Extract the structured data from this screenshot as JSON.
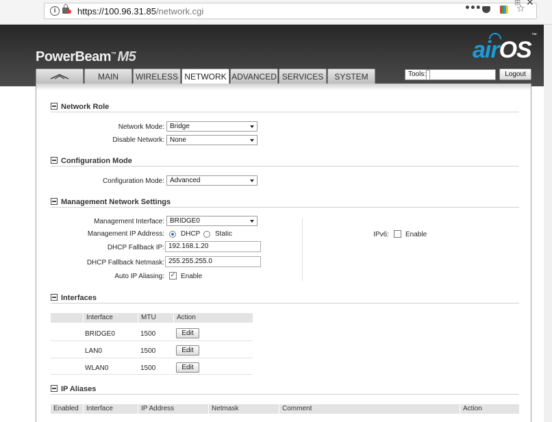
{
  "browser": {
    "url_host": "https://100.96.31.85",
    "url_path": "/network.cgi",
    "icons": [
      "info-icon",
      "lock-icon",
      "more-dots-icon",
      "pocket-icon",
      "extension-icon",
      "bookmark-star-icon",
      "close-icon"
    ]
  },
  "header": {
    "product": "PowerBeam",
    "model": "M5",
    "logo_air": "air",
    "logo_os": "OS",
    "tm": "™"
  },
  "tabs": [
    {
      "label": "",
      "icon": "ubiquiti-logo-icon"
    },
    {
      "label": "MAIN"
    },
    {
      "label": "WIRELESS"
    },
    {
      "label": "NETWORK",
      "active": true
    },
    {
      "label": "ADVANCED"
    },
    {
      "label": "SERVICES"
    },
    {
      "label": "SYSTEM"
    }
  ],
  "tools": {
    "value": "Tools:",
    "logout": "Logout"
  },
  "network_role": {
    "title": "Network Role",
    "mode_label": "Network Mode:",
    "mode_value": "Bridge",
    "disable_label": "Disable Network:",
    "disable_value": "None"
  },
  "configuration_mode": {
    "title": "Configuration Mode",
    "label": "Configuration Mode:",
    "value": "Advanced"
  },
  "management": {
    "title": "Management Network Settings",
    "interface_label": "Management Interface:",
    "interface_value": "BRIDGE0",
    "ip_label": "Management IP Address:",
    "dhcp": "DHCP",
    "static": "Static",
    "selected": "DHCP",
    "fallback_ip_label": "DHCP Fallback IP:",
    "fallback_ip": "192.168.1.20",
    "fallback_mask_label": "DHCP Fallback Netmask:",
    "fallback_mask": "255.255.255.0",
    "aliasing_label": "Auto IP Aliasing:",
    "aliasing_text": "Enable",
    "aliasing_checked": true,
    "ipv6_label": "IPv6:",
    "ipv6_text": "Enable",
    "ipv6_checked": false
  },
  "interfaces": {
    "title": "Interfaces",
    "headers": [
      "Interface",
      "MTU",
      "Action"
    ],
    "rows": [
      {
        "name": "BRIDGE0",
        "mtu": "1500",
        "action": "Edit"
      },
      {
        "name": "LAN0",
        "mtu": "1500",
        "action": "Edit"
      },
      {
        "name": "WLAN0",
        "mtu": "1500",
        "action": "Edit"
      }
    ]
  },
  "ip_aliases": {
    "title": "IP Aliases",
    "headers": [
      "Enabled",
      "Interface",
      "IP Address",
      "Netmask",
      "Comment",
      "Action"
    ]
  }
}
